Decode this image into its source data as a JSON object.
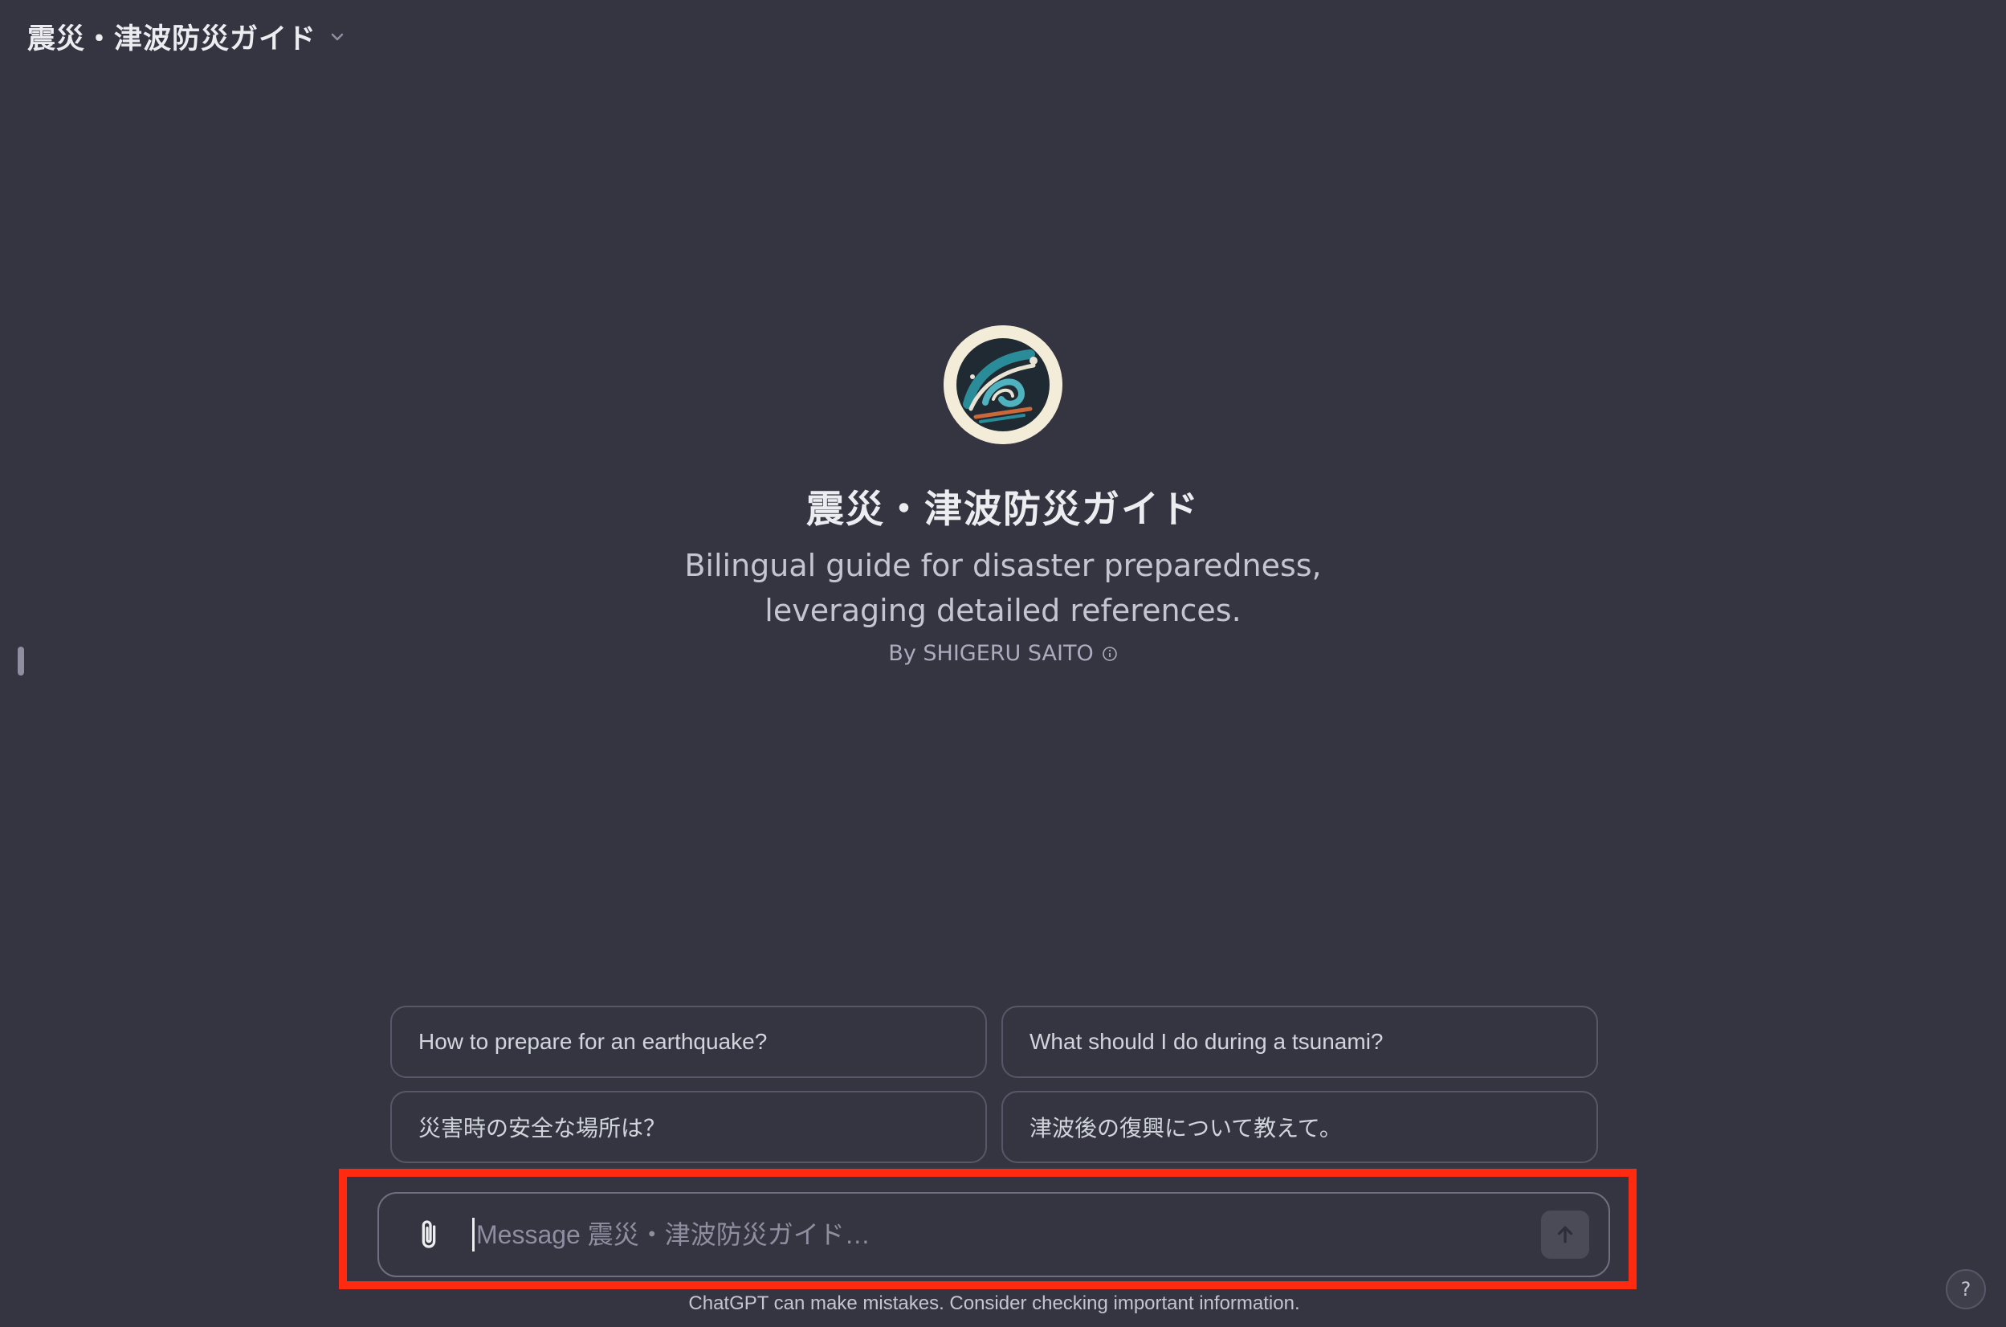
{
  "header": {
    "title": "震災・津波防災ガイド",
    "chevron_icon": "chevron-down-icon"
  },
  "gpt": {
    "name": "震災・津波防災ガイド",
    "description": "Bilingual guide for disaster preparedness, leveraging detailed references.",
    "author": "By SHIGERU SAITO",
    "info_icon": "info-icon"
  },
  "suggestions": [
    {
      "label": "How to prepare for an earthquake?"
    },
    {
      "label": "What should I do during a tsunami?"
    },
    {
      "label": "災害時の安全な場所は？"
    },
    {
      "label": "津波後の復興について教えて。"
    }
  ],
  "composer": {
    "placeholder": "Message 震災・津波防災ガイド…",
    "value": "",
    "attach_icon": "paperclip-icon",
    "send_icon": "arrow-up-icon"
  },
  "disclaimer": "ChatGPT can make mistakes. Consider checking important information.",
  "help": {
    "label": "?"
  },
  "colors": {
    "background": "#343541",
    "highlight": "#ff2a0f"
  }
}
